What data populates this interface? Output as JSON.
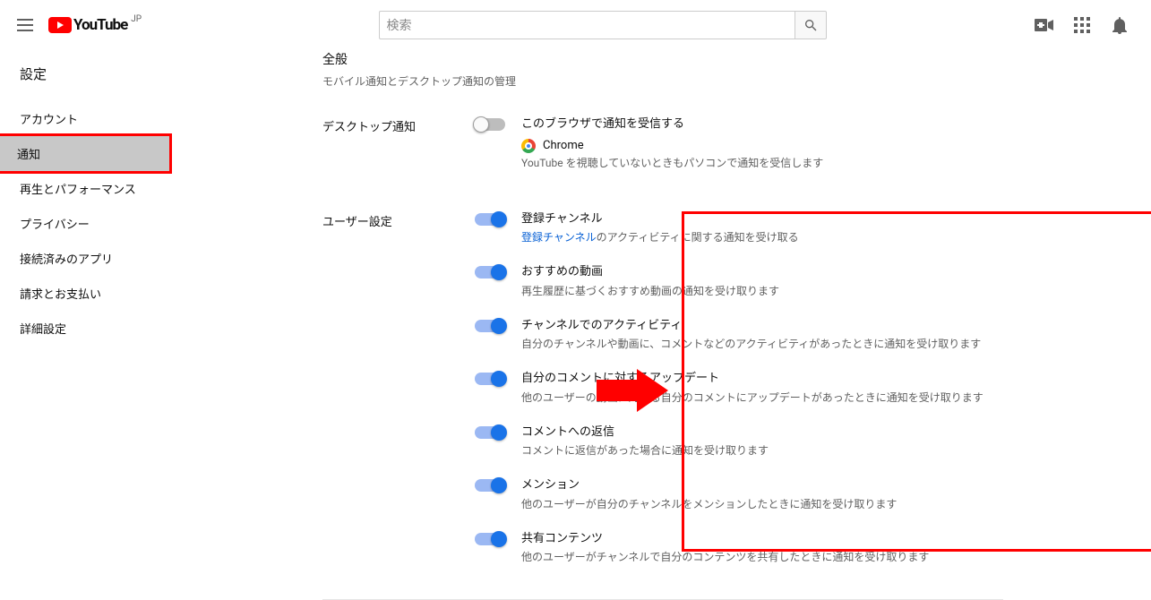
{
  "header": {
    "logo_text": "YouTube",
    "locale_sup": "JP",
    "search_placeholder": "検索"
  },
  "sidebar": {
    "heading": "設定",
    "items": [
      {
        "label": "アカウント"
      },
      {
        "label": "通知"
      },
      {
        "label": "再生とパフォーマンス"
      },
      {
        "label": "プライバシー"
      },
      {
        "label": "接続済みのアプリ"
      },
      {
        "label": "請求とお支払い"
      },
      {
        "label": "詳細設定"
      }
    ],
    "active_index": 1
  },
  "page": {
    "general_title": "全般",
    "general_sub": "モバイル通知とデスクトップ通知の管理",
    "desktop": {
      "label": "デスクトップ通知",
      "browser_title": "このブラウザで通知を受信する",
      "browser_name": "Chrome",
      "browser_desc": "YouTube を視聴していないときもパソコンで通知を受信します",
      "enabled": false
    },
    "user": {
      "label": "ユーザー設定",
      "items": [
        {
          "title": "登録チャンネル",
          "desc_prefix_link": "登録チャンネル",
          "desc_suffix": "のアクティビティに関する通知を受け取る",
          "enabled": true
        },
        {
          "title": "おすすめの動画",
          "desc": "再生履歴に基づくおすすめ動画の通知を受け取ります",
          "enabled": true
        },
        {
          "title": "チャンネルでのアクティビティ",
          "desc": "自分のチャンネルや動画に、コメントなどのアクティビティがあったときに通知を受け取ります",
          "enabled": true
        },
        {
          "title": "自分のコメントに対するアップデート",
          "desc": "他のユーザーの動画に対する自分のコメントにアップデートがあったときに通知を受け取ります",
          "enabled": true
        },
        {
          "title": "コメントへの返信",
          "desc": "コメントに返信があった場合に通知を受け取ります",
          "enabled": true
        },
        {
          "title": "メンション",
          "desc": "他のユーザーが自分のチャンネルをメンションしたときに通知を受け取ります",
          "enabled": true
        },
        {
          "title": "共有コンテンツ",
          "desc": "他のユーザーがチャンネルで自分のコンテンツを共有したときに通知を受け取ります",
          "enabled": true
        }
      ]
    }
  }
}
